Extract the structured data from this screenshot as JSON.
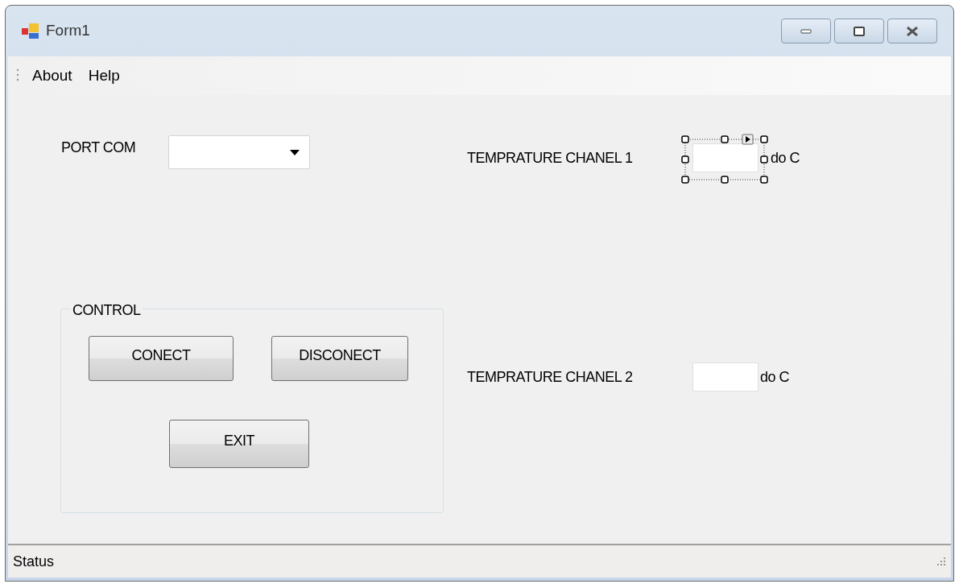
{
  "window": {
    "title": "Form1"
  },
  "menu": [
    {
      "label": "About"
    },
    {
      "label": "Help"
    }
  ],
  "port": {
    "label": "PORT COM"
  },
  "channels": [
    {
      "label": "TEMPRATURE CHANEL 1",
      "unit": "do C",
      "selected": true
    },
    {
      "label": "TEMPRATURE CHANEL 2",
      "unit": "do C",
      "selected": false
    }
  ],
  "control_group": {
    "title": "CONTROL",
    "buttons": [
      "CONECT",
      "DISCONECT",
      "EXIT"
    ]
  },
  "status_bar": {
    "text": "Status"
  }
}
